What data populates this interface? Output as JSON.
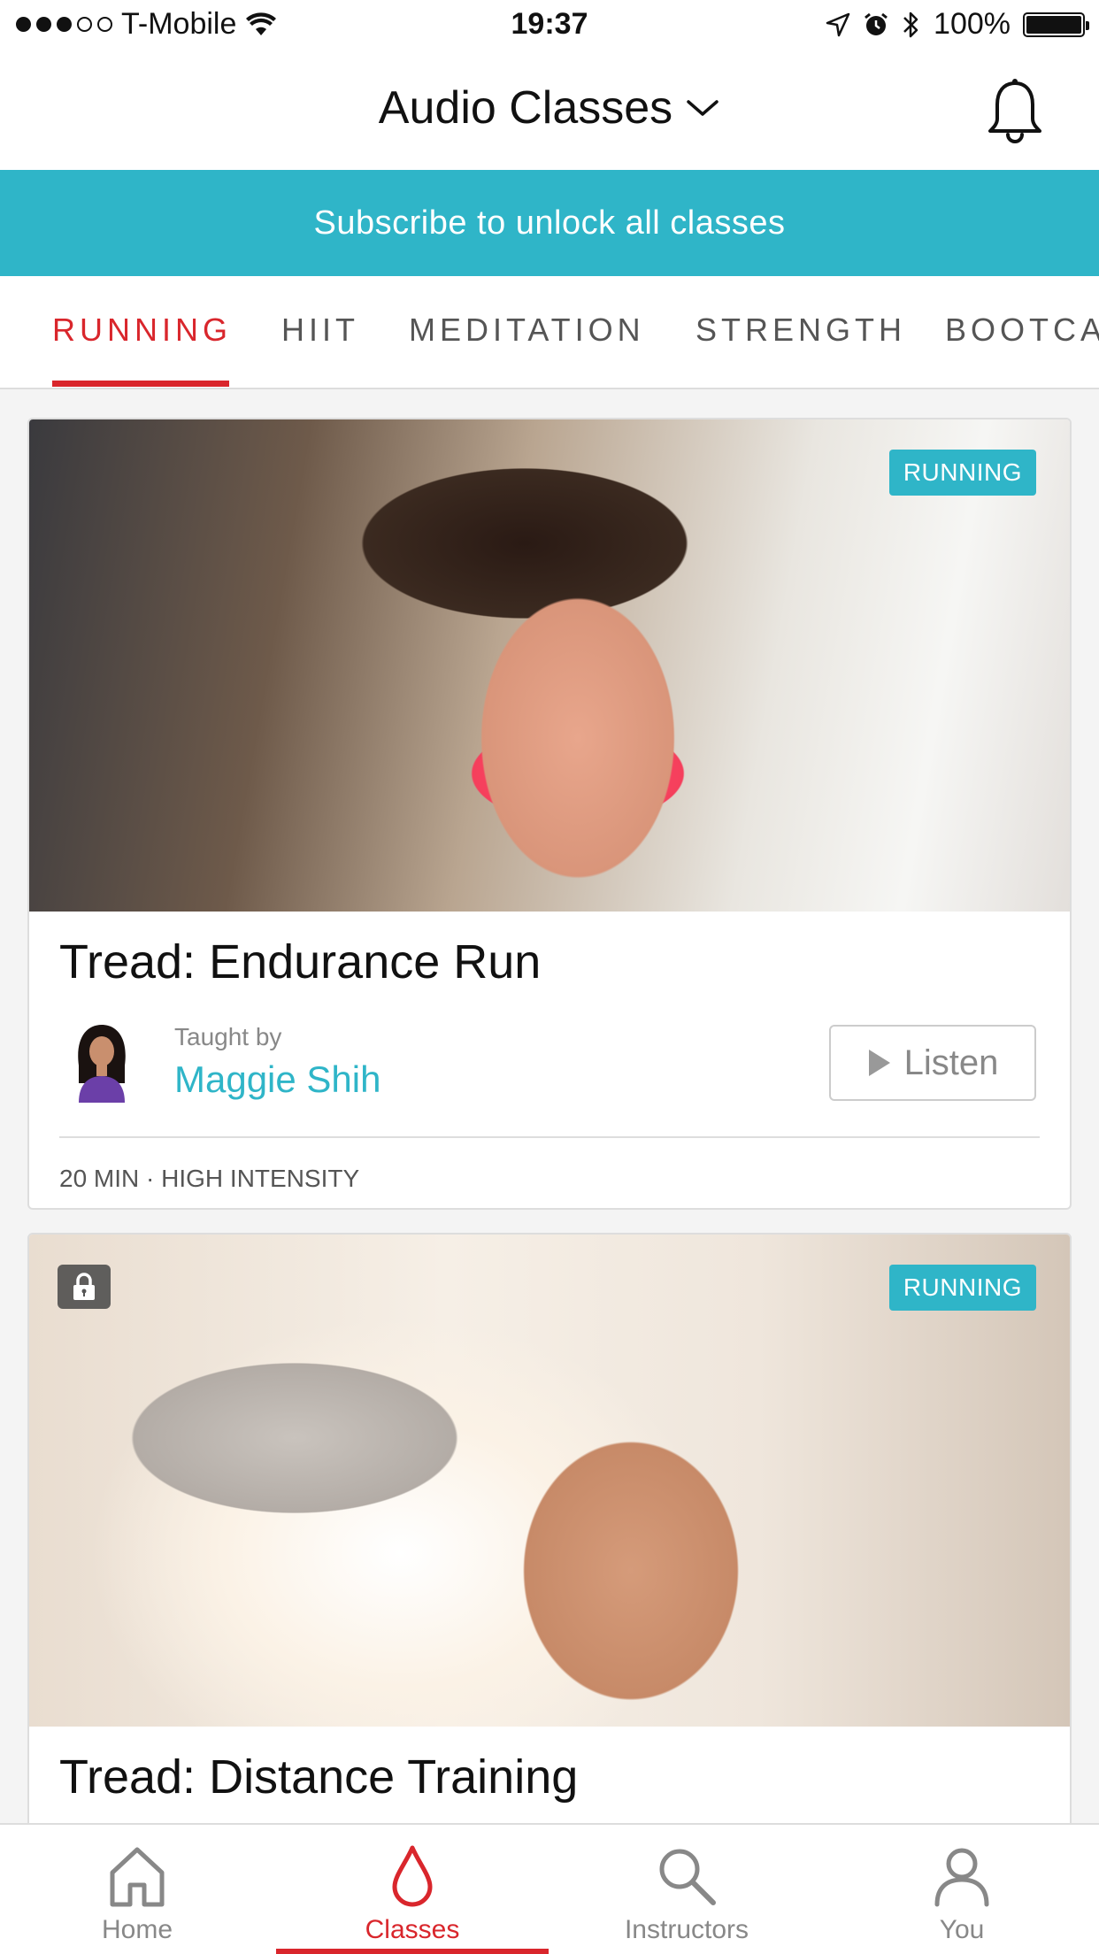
{
  "status_bar": {
    "carrier": "T-Mobile",
    "time": "19:37",
    "battery": "100%",
    "battery_level": 1.0,
    "signal_bars_filled": 3,
    "signal_bars_total": 5
  },
  "header": {
    "title": "Audio Classes",
    "dropdown_icon": "chevron-down-icon",
    "bell_icon": "bell-icon"
  },
  "banner": {
    "text": "Subscribe to unlock all classes"
  },
  "category_tabs": [
    {
      "label": "RUNNING",
      "active": true
    },
    {
      "label": "HIIT",
      "active": false
    },
    {
      "label": "MEDITATION",
      "active": false
    },
    {
      "label": "STRENGTH",
      "active": false
    },
    {
      "label": "BOOTCA",
      "active": false
    }
  ],
  "cards": [
    {
      "badge": "RUNNING",
      "locked": false,
      "title": "Tread: Endurance Run",
      "taught_by_label": "Taught by",
      "instructor": "Maggie Shih",
      "listen_label": "Listen",
      "meta": "20 MIN · HIGH INTENSITY"
    },
    {
      "badge": "RUNNING",
      "locked": true,
      "title": "Tread: Distance Training"
    }
  ],
  "tab_bar": [
    {
      "label": "Home",
      "icon": "home-icon",
      "active": false
    },
    {
      "label": "Classes",
      "icon": "drop-icon",
      "active": true
    },
    {
      "label": "Instructors",
      "icon": "search-icon",
      "active": false
    },
    {
      "label": "You",
      "icon": "person-icon",
      "active": false
    }
  ],
  "colors": {
    "accent_red": "#d9262c",
    "accent_teal": "#2fb5c8"
  }
}
